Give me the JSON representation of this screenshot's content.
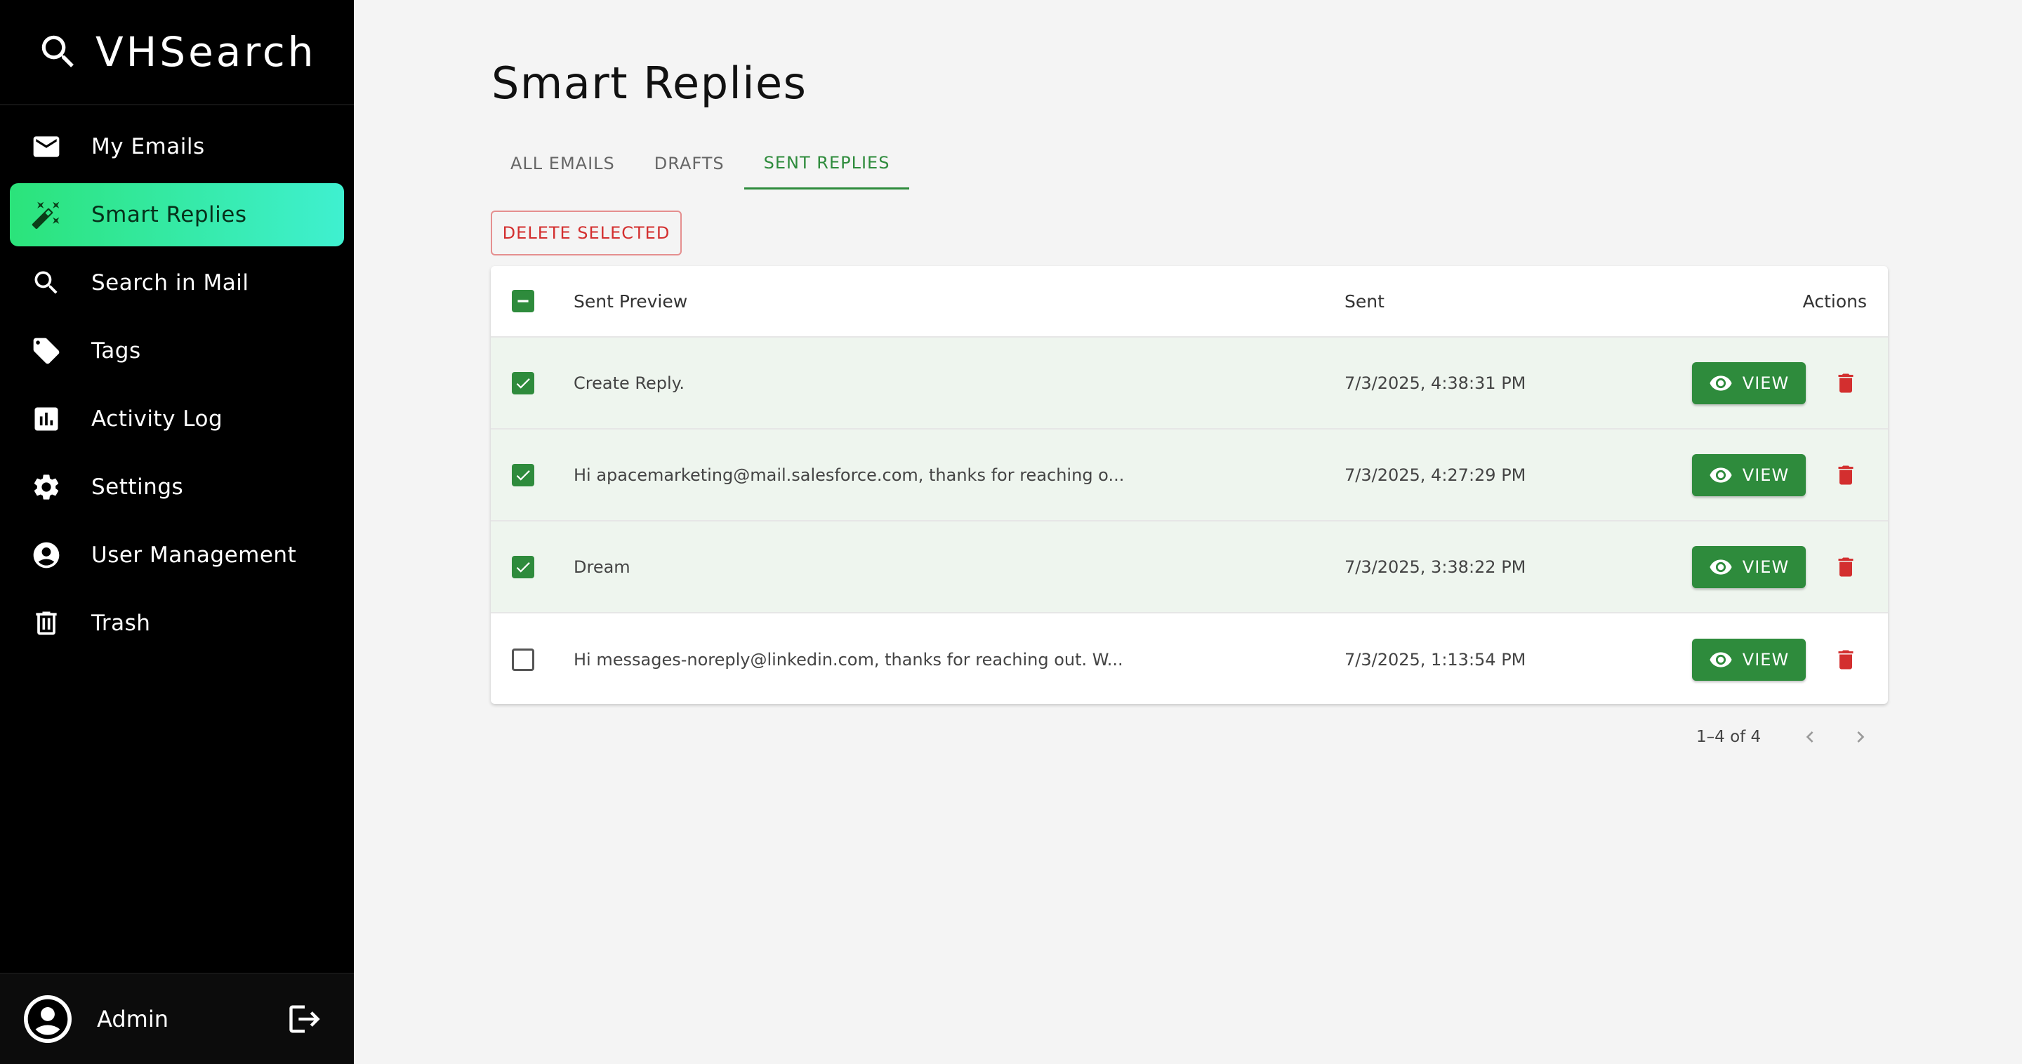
{
  "app": {
    "name": "VHSearch"
  },
  "sidebar": {
    "items": [
      {
        "label": "My Emails",
        "icon": "mail-icon",
        "active": false
      },
      {
        "label": "Smart Replies",
        "icon": "magic-wand-icon",
        "active": true
      },
      {
        "label": "Search in Mail",
        "icon": "search-icon",
        "active": false
      },
      {
        "label": "Tags",
        "icon": "tags-icon",
        "active": false
      },
      {
        "label": "Activity Log",
        "icon": "bar-chart-icon",
        "active": false
      },
      {
        "label": "Settings",
        "icon": "gear-icon",
        "active": false
      },
      {
        "label": "User Management",
        "icon": "account-circle-icon",
        "active": false
      },
      {
        "label": "Trash",
        "icon": "trash-icon",
        "active": false
      }
    ],
    "user": {
      "name": "Admin"
    }
  },
  "page": {
    "title": "Smart Replies",
    "tabs": [
      {
        "label": "ALL EMAILS",
        "active": false
      },
      {
        "label": "DRAFTS",
        "active": false
      },
      {
        "label": "SENT REPLIES",
        "active": true
      }
    ],
    "delete_selected_label": "DELETE SELECTED"
  },
  "table": {
    "columns": {
      "preview": "Sent Preview",
      "sent": "Sent",
      "actions": "Actions"
    },
    "view_label": "VIEW",
    "rows": [
      {
        "preview": "Create Reply.",
        "sent": "7/3/2025, 4:38:31 PM",
        "checked": true
      },
      {
        "preview": "Hi apacemarketing@mail.salesforce.com, thanks for reaching o...",
        "sent": "7/3/2025, 4:27:29 PM",
        "checked": true
      },
      {
        "preview": "Dream",
        "sent": "7/3/2025, 3:38:22 PM",
        "checked": true
      },
      {
        "preview": "Hi messages-noreply@linkedin.com, thanks for reaching out. W...",
        "sent": "7/3/2025, 1:13:54 PM",
        "checked": false
      }
    ]
  },
  "pagination": {
    "range": "1–4 of 4"
  },
  "colors": {
    "accent_green": "#2e8b3c",
    "active_nav_gradient_start": "#2be37a",
    "active_nav_gradient_end": "#3ff0d0",
    "danger_red": "#d32f2f",
    "selected_row_bg": "#eef5ee"
  }
}
